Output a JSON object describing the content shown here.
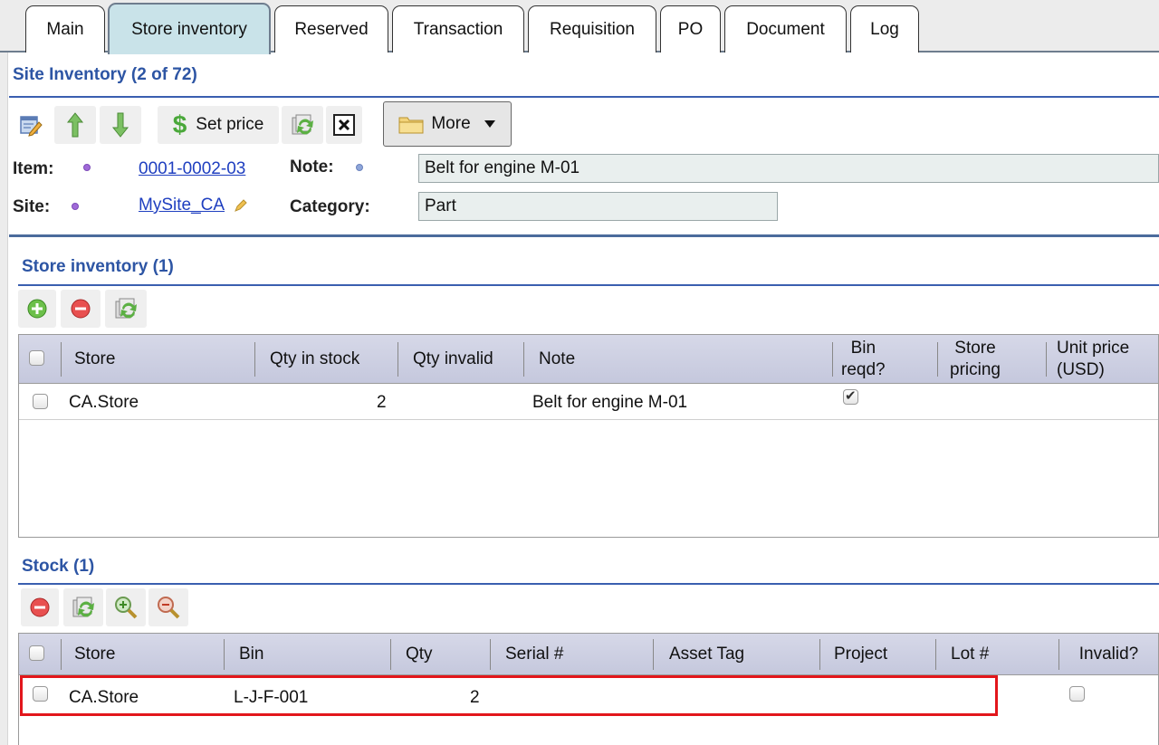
{
  "tabs": [
    {
      "label": "Main",
      "active": false
    },
    {
      "label": "Store inventory",
      "active": true
    },
    {
      "label": "Reserved",
      "active": false
    },
    {
      "label": "Transaction",
      "active": false
    },
    {
      "label": "Requisition",
      "active": false
    },
    {
      "label": "PO",
      "active": false
    },
    {
      "label": "Document",
      "active": false
    },
    {
      "label": "Log",
      "active": false
    }
  ],
  "site_inventory": {
    "title": "Site Inventory (2 of 72)",
    "toolbar": {
      "set_price_label": "Set price",
      "more_label": "More"
    },
    "form": {
      "item_label": "Item:",
      "item_value": "0001-0002-03",
      "site_label": "Site:",
      "site_value": "MySite_CA",
      "note_label": "Note:",
      "note_value": "Belt for engine M-01",
      "category_label": "Category:",
      "category_value": "Part"
    }
  },
  "store_inventory": {
    "title": "Store inventory (1)",
    "columns": {
      "store": "Store",
      "qty_in_stock": "Qty in stock",
      "qty_invalid": "Qty invalid",
      "note": "Note",
      "bin_reqd_1": "Bin",
      "bin_reqd_2": "reqd?",
      "store_pricing_1": "Store",
      "store_pricing_2": "pricing",
      "unit_price_1": "Unit price",
      "unit_price_2": "(USD)"
    },
    "rows": [
      {
        "store": "CA.Store",
        "qty_in_stock": "2",
        "qty_invalid": "",
        "note": "Belt for engine M-01",
        "bin_reqd": true
      }
    ]
  },
  "stock": {
    "title": "Stock (1)",
    "columns": {
      "store": "Store",
      "bin": "Bin",
      "qty": "Qty",
      "serial": "Serial #",
      "asset_tag": "Asset Tag",
      "project": "Project",
      "lot": "Lot #",
      "invalid": "Invalid?"
    },
    "rows": [
      {
        "store": "CA.Store",
        "bin": "L-J-F-001",
        "qty": "2",
        "serial": "",
        "asset_tag": "",
        "project": "",
        "lot": "",
        "invalid": false
      }
    ]
  },
  "colors": {
    "section_title": "#2d55a4",
    "highlight": "#e2161c",
    "active_tab": "#c9e3e9"
  }
}
